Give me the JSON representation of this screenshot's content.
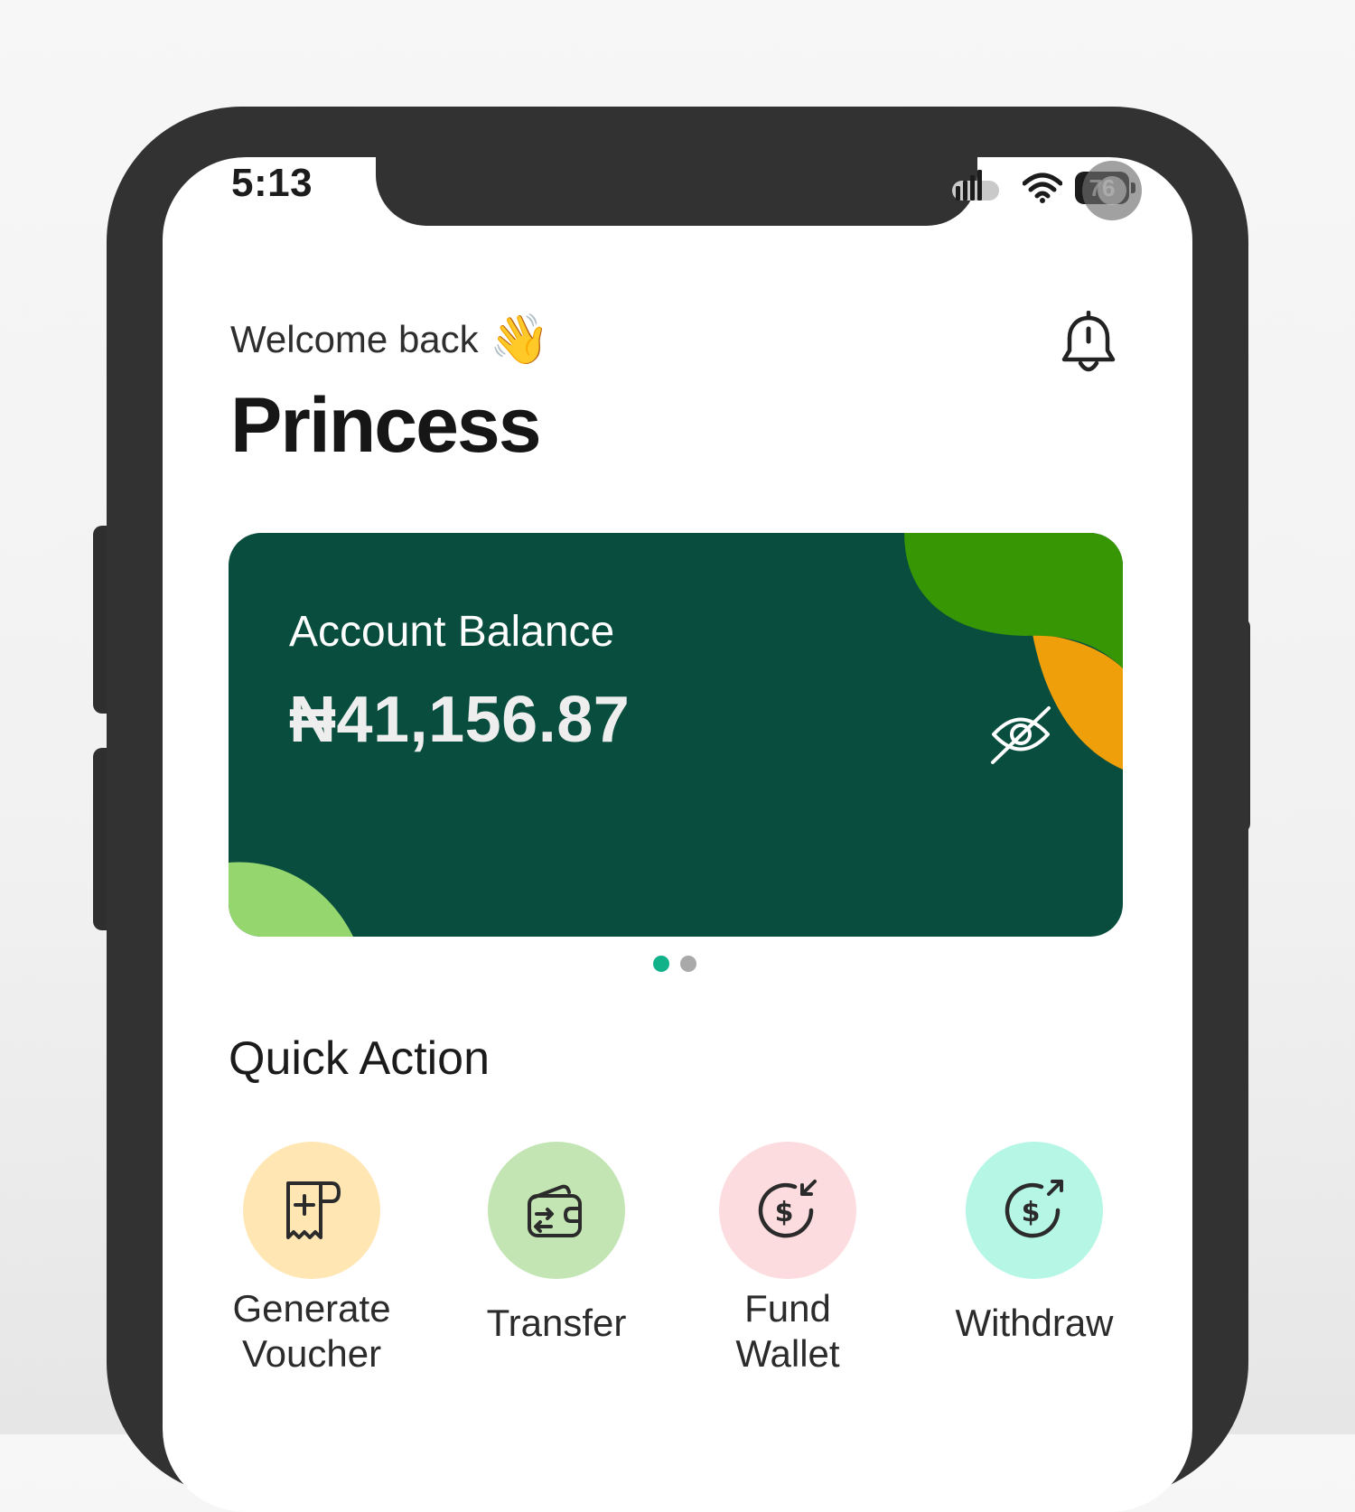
{
  "status_bar": {
    "time": "5:13",
    "battery": "76"
  },
  "header": {
    "greeting": "Welcome back",
    "greeting_emoji": "👋",
    "user_name": "Princess",
    "notification_icon": "bell-icon"
  },
  "balance_card": {
    "label": "Account Balance",
    "amount": "₦41,156.87",
    "toggle_icon": "eye-off-icon",
    "colors": {
      "card": "#084d3d",
      "accent_green": "#369603",
      "accent_orange": "#ee9f0a",
      "accent_light": "#95d66f"
    }
  },
  "carousel": {
    "pages": 2,
    "active_page": 1
  },
  "quick_action": {
    "title": "Quick Action",
    "items": [
      {
        "label": "Generate\nVoucher",
        "icon": "voucher-add-icon",
        "bg": "#ffe6b3"
      },
      {
        "label": "Transfer",
        "icon": "wallet-transfer-icon",
        "bg": "#c3e5b3"
      },
      {
        "label": "Fund\nWallet",
        "icon": "dollar-in-icon",
        "bg": "#fcdcde"
      },
      {
        "label": "Withdraw",
        "icon": "dollar-out-icon",
        "bg": "#b5f6e5"
      }
    ]
  }
}
